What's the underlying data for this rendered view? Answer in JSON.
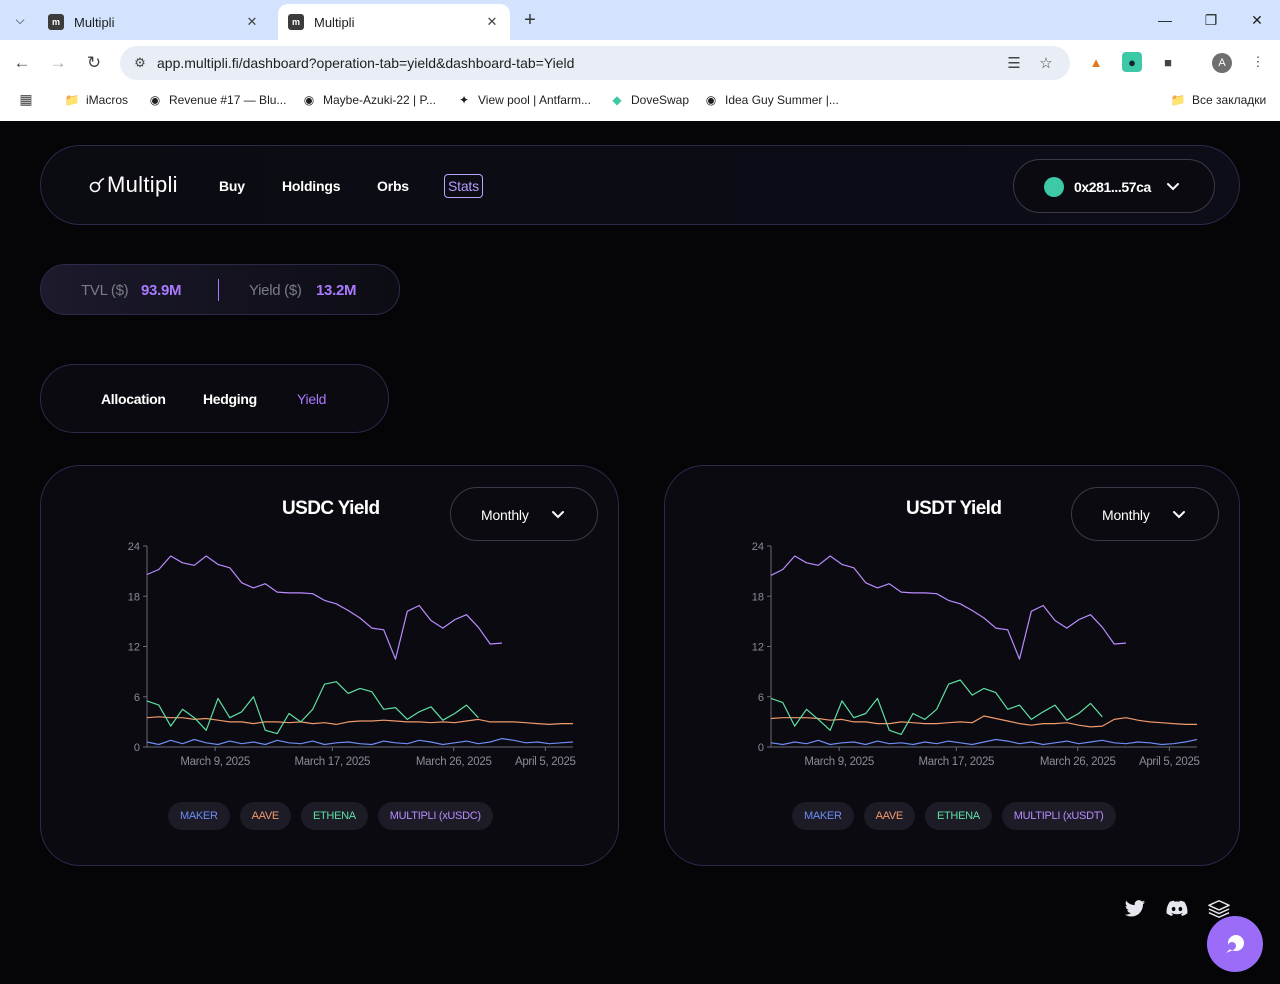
{
  "browser": {
    "tabs": [
      {
        "title": "Multipli",
        "active": false
      },
      {
        "title": "Multipli",
        "active": true
      }
    ],
    "url": "app.multipli.fi/dashboard?operation-tab=yield&dashboard-tab=Yield",
    "profile_initial": "A",
    "bookmarks": [
      {
        "label": "iMacros",
        "icon": "folder-icon"
      },
      {
        "label": "Revenue #17 — Blu...",
        "icon": "site-icon"
      },
      {
        "label": "Maybe-Azuki-22 | P...",
        "icon": "site-icon"
      },
      {
        "label": "View pool | Antfarm...",
        "icon": "site-icon"
      },
      {
        "label": "DoveSwap",
        "icon": "site-icon"
      },
      {
        "label": "Idea Guy Summer |...",
        "icon": "site-icon"
      }
    ],
    "all_bookmarks": "Все закладки"
  },
  "app": {
    "logo_text": "Multipli",
    "nav": [
      "Buy",
      "Holdings",
      "Orbs",
      "Stats"
    ],
    "active_nav": "Stats",
    "wallet_address": "0x281...57ca",
    "tvl_label": "TVL ($)",
    "tvl_value": "93.9M",
    "yield_label": "Yield ($)",
    "yield_value": "13.2M",
    "operation_tabs": [
      "Allocation",
      "Hedging",
      "Yield"
    ],
    "active_operation_tab": "Yield",
    "colors": {
      "accent": "#a979ff",
      "maker": "#6f8cf2",
      "aave": "#f0996b",
      "ethena": "#5fe0a3",
      "multipli": "#b98cff"
    }
  },
  "chart_data": [
    {
      "type": "line",
      "title": "USDC Yield",
      "period": "Monthly",
      "ylim": [
        0,
        24
      ],
      "yticks": [
        "0",
        "6",
        "12",
        "18",
        "24"
      ],
      "xtick_labels": [
        "March 9, 2025",
        "March 17, 2025",
        "March 26, 2025",
        "April 5, 2025"
      ],
      "x_count": 37,
      "series": [
        {
          "name": "MAKER",
          "values": [
            0.6,
            0.3,
            0.8,
            0.4,
            0.9,
            0.5,
            0.3,
            0.7,
            0.4,
            0.6,
            0.3,
            0.8,
            0.5,
            0.4,
            0.7,
            0.3,
            0.5,
            0.6,
            0.4,
            0.3,
            0.7,
            0.5,
            0.4,
            0.8,
            0.6,
            0.3,
            0.5,
            0.7,
            0.4,
            0.6,
            1.0,
            0.8,
            0.5,
            0.6,
            0.4,
            0.5,
            0.6
          ]
        },
        {
          "name": "AAVE",
          "values": [
            3.5,
            3.6,
            3.5,
            3.5,
            3.3,
            3.4,
            3.2,
            3.0,
            3.0,
            2.8,
            3.0,
            3.0,
            2.9,
            3.0,
            2.8,
            2.9,
            2.7,
            3.0,
            3.1,
            3.1,
            3.2,
            3.1,
            3.0,
            3.0,
            2.9,
            3.0,
            2.9,
            3.1,
            3.3,
            3.0,
            3.0,
            3.0,
            2.9,
            2.8,
            2.7,
            2.8,
            2.8
          ]
        },
        {
          "name": "ETHENA",
          "values": [
            5.5,
            5.0,
            2.5,
            4.5,
            3.5,
            2.0,
            5.8,
            3.5,
            4.2,
            6.0,
            2.0,
            1.6,
            4.0,
            3.0,
            4.5,
            7.5,
            7.8,
            6.4,
            7.0,
            6.6,
            4.5,
            4.7,
            3.3,
            4.2,
            4.8,
            3.2,
            4.0,
            5.0,
            3.5,
            null,
            null,
            null,
            null,
            null,
            null,
            null,
            null
          ]
        },
        {
          "name": "MULTIPLI (xUSDC)",
          "values": [
            20.6,
            21.2,
            22.8,
            22.0,
            21.7,
            22.8,
            21.8,
            21.4,
            19.6,
            19.0,
            19.5,
            18.5,
            18.4,
            18.4,
            18.3,
            17.5,
            17.1,
            16.3,
            15.4,
            14.2,
            14.0,
            10.5,
            16.2,
            16.9,
            15.1,
            14.2,
            15.2,
            15.8,
            14.3,
            12.3,
            12.4,
            null,
            null,
            null,
            null,
            null,
            null
          ]
        }
      ],
      "legend": [
        "MAKER",
        "AAVE",
        "ETHENA",
        "MULTIPLI (xUSDC)"
      ]
    },
    {
      "type": "line",
      "title": "USDT Yield",
      "period": "Monthly",
      "ylim": [
        0,
        24
      ],
      "yticks": [
        "0",
        "6",
        "12",
        "18",
        "24"
      ],
      "xtick_labels": [
        "March 9, 2025",
        "March 17, 2025",
        "March 26, 2025",
        "April 5, 2025"
      ],
      "x_count": 37,
      "series": [
        {
          "name": "MAKER",
          "values": [
            0.5,
            0.3,
            0.6,
            0.4,
            0.8,
            0.3,
            0.5,
            0.6,
            0.3,
            0.7,
            0.4,
            0.5,
            0.3,
            0.6,
            0.4,
            0.7,
            0.5,
            0.3,
            0.6,
            0.9,
            0.7,
            0.4,
            0.6,
            0.3,
            0.5,
            0.7,
            0.4,
            0.6,
            0.8,
            0.5,
            0.4,
            0.6,
            0.5,
            0.3,
            0.4,
            0.6,
            0.9
          ]
        },
        {
          "name": "AAVE",
          "values": [
            3.4,
            3.5,
            3.5,
            3.5,
            3.4,
            3.2,
            3.3,
            3.0,
            3.0,
            2.8,
            2.8,
            3.0,
            2.9,
            2.8,
            2.8,
            2.9,
            3.0,
            2.9,
            3.7,
            3.4,
            3.1,
            2.8,
            2.6,
            2.8,
            2.8,
            2.9,
            2.6,
            2.4,
            2.5,
            3.3,
            3.5,
            3.2,
            3.0,
            2.9,
            2.8,
            2.7,
            2.7
          ]
        },
        {
          "name": "ETHENA",
          "values": [
            5.8,
            5.3,
            2.5,
            4.5,
            3.3,
            2.0,
            5.5,
            3.5,
            4.0,
            5.8,
            2.0,
            1.5,
            4.0,
            3.3,
            4.5,
            7.5,
            8.0,
            6.2,
            7.0,
            6.5,
            4.5,
            5.0,
            3.3,
            4.2,
            5.0,
            3.2,
            4.0,
            5.2,
            3.6,
            null,
            null,
            null,
            null,
            null,
            null,
            null,
            null
          ]
        },
        {
          "name": "MULTIPLI (xUSDT)",
          "values": [
            20.5,
            21.2,
            22.8,
            22.0,
            21.7,
            22.8,
            21.8,
            21.4,
            19.6,
            19.0,
            19.5,
            18.5,
            18.4,
            18.4,
            18.3,
            17.5,
            17.1,
            16.3,
            15.4,
            14.2,
            14.0,
            10.5,
            16.2,
            16.9,
            15.1,
            14.2,
            15.2,
            15.8,
            14.3,
            12.3,
            12.4,
            null,
            null,
            null,
            null,
            null,
            null
          ]
        }
      ],
      "legend": [
        "MAKER",
        "AAVE",
        "ETHENA",
        "MULTIPLI (xUSDT)"
      ]
    }
  ]
}
